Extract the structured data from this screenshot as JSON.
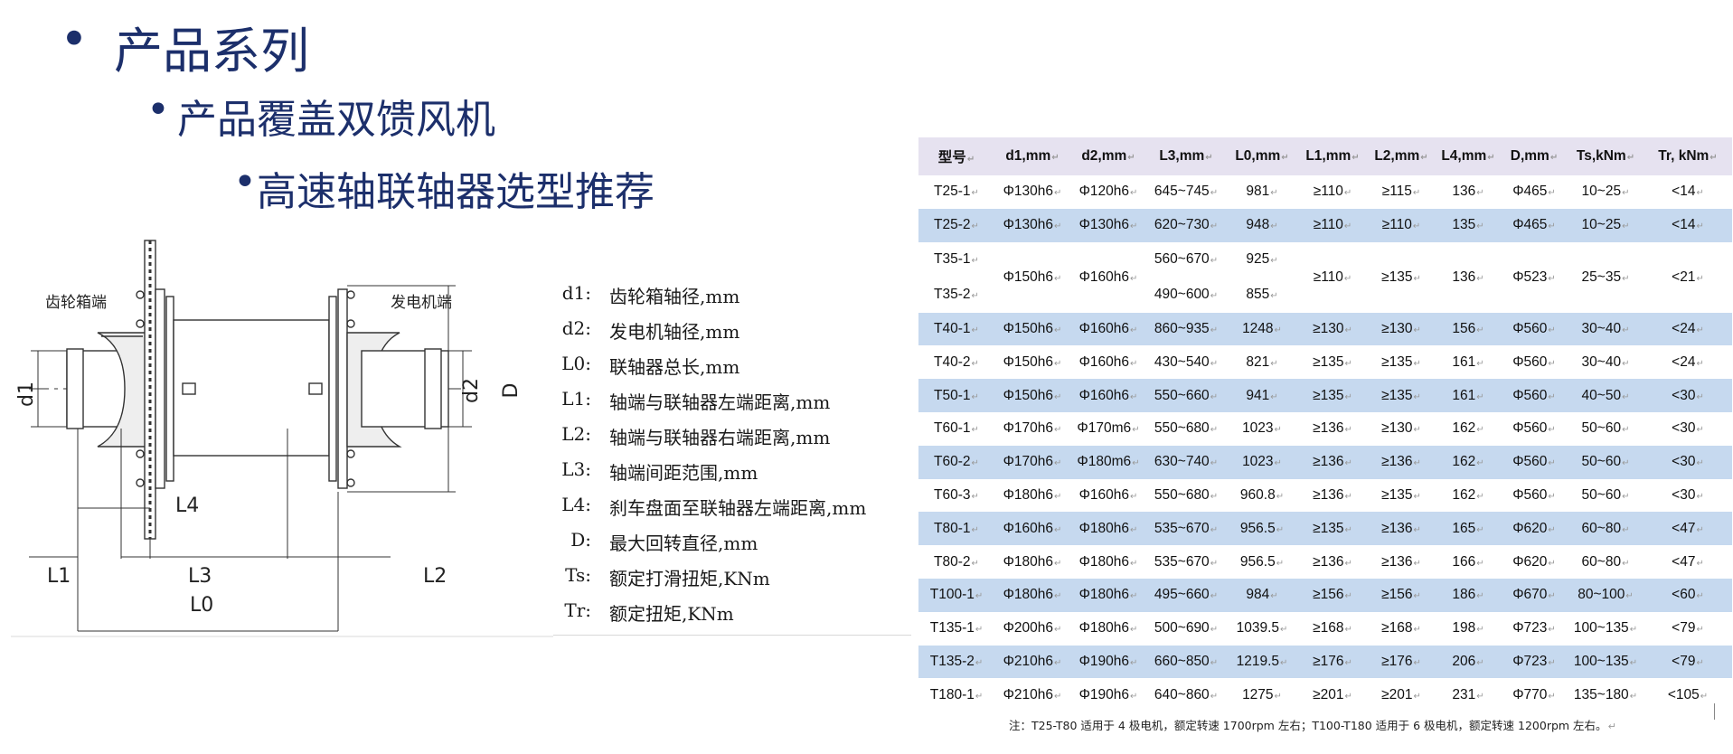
{
  "bullets": {
    "level1": "产品系列",
    "level2": "产品覆盖双馈风机",
    "level3": "高速轴联轴器选型推荐",
    "marker": "•"
  },
  "diagram": {
    "gearbox_end": "齿轮箱端",
    "generator_end": "发电机端",
    "labels": {
      "d1": "d1",
      "d2": "d2",
      "D": "D",
      "L0": "L0",
      "L1": "L1",
      "L2": "L2",
      "L3": "L3",
      "L4": "L4"
    }
  },
  "legend": [
    {
      "key": "d1:",
      "desc": "齿轮箱轴径,mm"
    },
    {
      "key": "d2:",
      "desc": "发电机轴径,mm"
    },
    {
      "key": "L0:",
      "desc": "联轴器总长,mm"
    },
    {
      "key": "L1:",
      "desc": "轴端与联轴器左端距离,mm"
    },
    {
      "key": "L2:",
      "desc": "轴端与联轴器右端距离,mm"
    },
    {
      "key": "L3:",
      "desc": "轴端间距范围,mm"
    },
    {
      "key": "L4:",
      "desc": "刹车盘面至联轴器左端距离,mm"
    },
    {
      "key": "D:",
      "desc": "最大回转直径,mm"
    },
    {
      "key": "Ts:",
      "desc": "额定打滑扭矩,KNm"
    },
    {
      "key": "Tr:",
      "desc": "额定扭矩,KNm"
    }
  ],
  "table": {
    "headers": [
      "型号",
      "d1,mm",
      "d2,mm",
      "L3,mm",
      "L0,mm",
      "L1,mm",
      "L2,mm",
      "L4,mm",
      "D,mm",
      "Ts,kNm",
      "Tr, kNm"
    ],
    "rows": [
      [
        "T25-1",
        "Φ130h6",
        "Φ120h6",
        "645~745",
        "981",
        "≥110",
        "≥115",
        "136",
        "Φ465",
        "10~25",
        "<14"
      ],
      [
        "T25-2",
        "Φ130h6",
        "Φ130h6",
        "620~730",
        "948",
        "≥110",
        "≥110",
        "135",
        "Φ465",
        "10~25",
        "<14"
      ],
      [
        "T35-1|T35-2",
        "Φ150h6",
        "Φ160h6",
        "560~670|490~600",
        "925|855",
        "≥110",
        "≥135",
        "136",
        "Φ523",
        "25~35",
        "<21"
      ],
      [
        "T40-1",
        "Φ150h6",
        "Φ160h6",
        "860~935",
        "1248",
        "≥130",
        "≥130",
        "156",
        "Φ560",
        "30~40",
        "<24"
      ],
      [
        "T40-2",
        "Φ150h6",
        "Φ160h6",
        "430~540",
        "821",
        "≥135",
        "≥135",
        "161",
        "Φ560",
        "30~40",
        "<24"
      ],
      [
        "T50-1",
        "Φ150h6",
        "Φ160h6",
        "550~660",
        "941",
        "≥135",
        "≥135",
        "161",
        "Φ560",
        "40~50",
        "<30"
      ],
      [
        "T60-1",
        "Φ170h6",
        "Φ170m6",
        "550~680",
        "1023",
        "≥136",
        "≥130",
        "162",
        "Φ560",
        "50~60",
        "<30"
      ],
      [
        "T60-2",
        "Φ170h6",
        "Φ180m6",
        "630~740",
        "1023",
        "≥136",
        "≥136",
        "162",
        "Φ560",
        "50~60",
        "<30"
      ],
      [
        "T60-3",
        "Φ180h6",
        "Φ160h6",
        "550~680",
        "960.8",
        "≥136",
        "≥135",
        "162",
        "Φ560",
        "50~60",
        "<30"
      ],
      [
        "T80-1",
        "Φ160h6",
        "Φ180h6",
        "535~670",
        "956.5",
        "≥135",
        "≥136",
        "165",
        "Φ620",
        "60~80",
        "<47"
      ],
      [
        "T80-2",
        "Φ180h6",
        "Φ180h6",
        "535~670",
        "956.5",
        "≥136",
        "≥136",
        "166",
        "Φ620",
        "60~80",
        "<47"
      ],
      [
        "T100-1",
        "Φ180h6",
        "Φ180h6",
        "495~660",
        "984",
        "≥156",
        "≥156",
        "186",
        "Φ670",
        "80~100",
        "<60"
      ],
      [
        "T135-1",
        "Φ200h6",
        "Φ180h6",
        "500~690",
        "1039.5",
        "≥168",
        "≥168",
        "198",
        "Φ723",
        "100~135",
        "<79"
      ],
      [
        "T135-2",
        "Φ210h6",
        "Φ190h6",
        "660~850",
        "1219.5",
        "≥176",
        "≥176",
        "206",
        "Φ723",
        "100~135",
        "<79"
      ],
      [
        "T180-1",
        "Φ210h6",
        "Φ190h6",
        "640~860",
        "1275",
        "≥201",
        "≥201",
        "231",
        "Φ770",
        "135~180",
        "<105"
      ]
    ],
    "shaded_rows": [
      1,
      3,
      5,
      7,
      9,
      11,
      13
    ]
  },
  "note": "注：T25-T80 适用于 4 极电机，额定转速 1700rpm 左右；T100-T180 适用于 6 极电机，额定转速 1200rpm 左右。",
  "colors": {
    "title": "#1c2f6b",
    "header_bg": "#e6e2f0",
    "shaded_row": "#c6d9ef"
  }
}
